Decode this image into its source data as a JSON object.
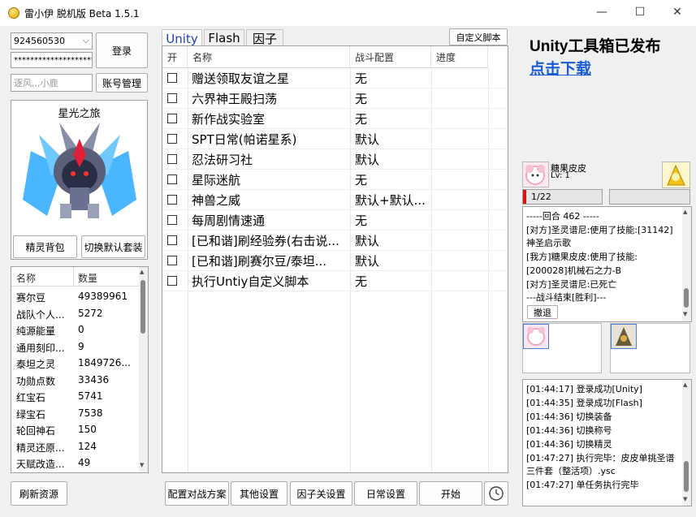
{
  "window": {
    "title": "雷小伊 脱机版 Beta 1.5.1",
    "controls": {
      "minimize": "—",
      "maximize": "☐",
      "close": "✕"
    }
  },
  "login": {
    "account": "924560530",
    "password": "**********************",
    "nickname": "逐风,,,小鹿",
    "login_label": "登录",
    "account_mgmt_label": "账号管理"
  },
  "sprite": {
    "name": "星光之旅",
    "bag_label": "精灵背包",
    "switch_suit_label": "切换默认套装"
  },
  "resources": {
    "headers": [
      "名称",
      "数量"
    ],
    "rows": [
      [
        "赛尔豆",
        "49389961"
      ],
      [
        "战队个人...",
        "5272"
      ],
      [
        "纯源能量",
        "0"
      ],
      [
        "通用刻印...",
        "9"
      ],
      [
        "泰坦之灵",
        "1849726..."
      ],
      [
        "功勋点数",
        "33436"
      ],
      [
        "红宝石",
        "5741"
      ],
      [
        "绿宝石",
        "7538"
      ],
      [
        "轮回神石",
        "150"
      ],
      [
        "精灵还原...",
        "124"
      ],
      [
        "天赋改造...",
        "49"
      ]
    ],
    "refresh_label": "刷新资源"
  },
  "tabs": [
    "Unity",
    "Flash",
    "因子"
  ],
  "custom_script_label": "自定义脚本",
  "task_table": {
    "headers": [
      "开",
      "名称",
      "战斗配置",
      "进度"
    ],
    "rows": [
      {
        "name": "赠送领取友谊之星",
        "config": "无"
      },
      {
        "name": "六界神王殿扫荡",
        "config": "无"
      },
      {
        "name": "新作战实验室",
        "config": "无"
      },
      {
        "name": "SPT日常(帕诺星系)",
        "config": "默认"
      },
      {
        "name": "忍法研习社",
        "config": "默认"
      },
      {
        "name": "星际迷航",
        "config": "无"
      },
      {
        "name": "神兽之威",
        "config": "默认+默认..."
      },
      {
        "name": "每周剧情速通",
        "config": "无"
      },
      {
        "name": "[已和谐]刷经验券(右击说...",
        "config": "默认"
      },
      {
        "name": "[已和谐]刷赛尔豆/泰坦...",
        "config": "默认"
      },
      {
        "name": "执行Untiy自定义脚本",
        "config": "无"
      }
    ]
  },
  "bottom_buttons": [
    "配置对战方案",
    "其他设置",
    "因子关设置",
    "日常设置",
    "开始"
  ],
  "clock_icon": "clock-icon",
  "ad": {
    "title": "Unity工具箱已发布",
    "link": "点击下载"
  },
  "battle": {
    "player_name": "糖果皮皮",
    "player_level": "Lv: 1",
    "hp_text": "1/22",
    "hp_fraction": 0.045,
    "log": [
      "-----回合 462 -----",
      "[对方]圣灵谱尼:使用了技能:[31142]",
      "神圣启示歌",
      "[我方]糖果皮皮:使用了技能:",
      "[200028]机械石之力-B",
      "[对方]圣灵谱尼:已死亡",
      "---战斗结束[胜利]---"
    ],
    "retreat_label": "撤退"
  },
  "system_log": [
    "[01:44:17] 登录成功[Unity]",
    "[01:44:35] 登录成功[Flash]",
    "[01:44:36] 切换装备",
    "[01:44:36] 切换称号",
    "[01:44:36] 切换精灵",
    "[01:47:27] 执行完毕：皮皮单挑圣谱",
    "三件套（整活项）.ysc",
    "[01:47:27] 单任务执行完毕"
  ],
  "colors": {
    "accent": "#1a3fb0",
    "link": "#1a5bd6",
    "hp_bar": "#e01010"
  }
}
